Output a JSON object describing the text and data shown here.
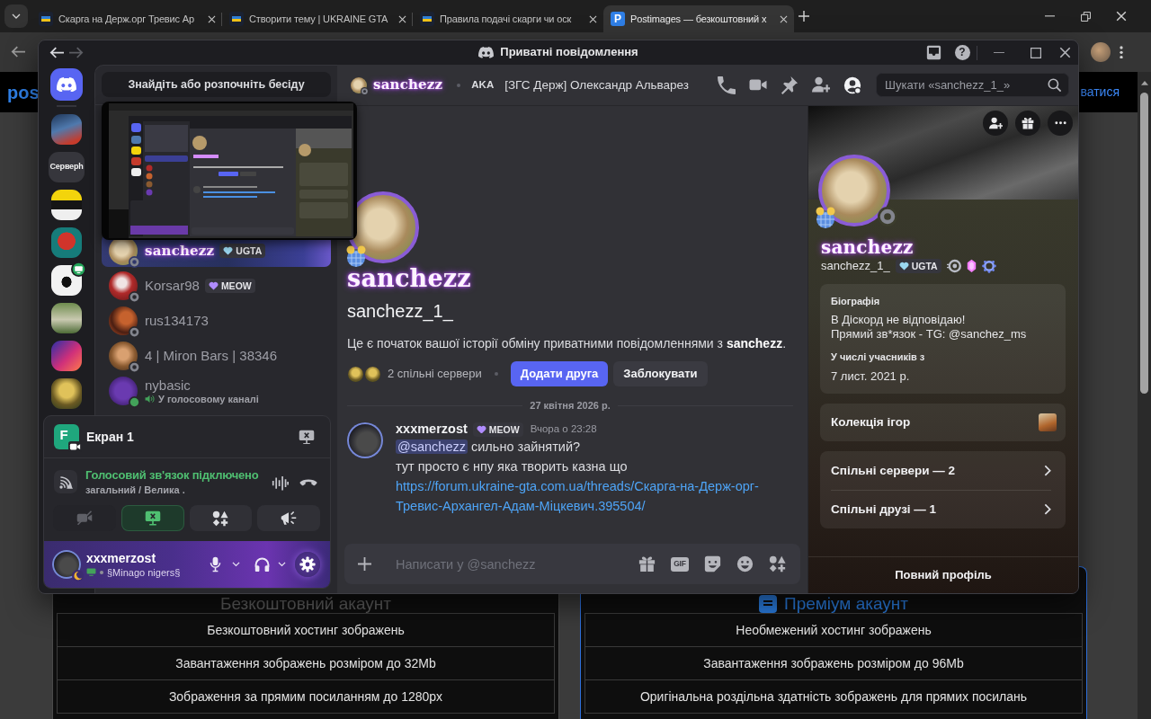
{
  "browser": {
    "tabs": [
      {
        "title": "Скарга на Держ.орг Тревис Ар",
        "favicon": {
          "kind": "crest"
        },
        "selected": false
      },
      {
        "title": "Створити тему | UKRAINE GTA",
        "favicon": {
          "kind": "crest"
        },
        "selected": false
      },
      {
        "title": "Правила подачі скарги чи оск",
        "favicon": {
          "kind": "crest"
        },
        "selected": false
      },
      {
        "title": "Postimages — безкоштовний х",
        "favicon": {
          "kind": "letter",
          "letter": "P"
        },
        "selected": true
      }
    ]
  },
  "page": {
    "logo": "pos",
    "account_link": "ватися",
    "plans": [
      {
        "title": "Безкоштовний акаунт",
        "featured": false,
        "features": [
          "Безкоштовний хостинг зображень",
          "Завантаження зображень розміром до 32Mb",
          "Зображення за прямим посиланням до 1280px"
        ]
      },
      {
        "title": "Преміум акаунт",
        "featured": true,
        "features": [
          "Необмежений хостинг зображень",
          "Завантаження зображень розміром до 96Mb",
          "Оригінальна роздільна здатність зображень для прямих посилань"
        ]
      }
    ]
  },
  "discord": {
    "title": "Приватні повідомлення",
    "help_label": "?",
    "servers": [
      {
        "kind": "image",
        "live": false
      },
      {
        "kind": "text",
        "label": "Серверh",
        "live": false
      },
      {
        "kind": "image",
        "live": false
      },
      {
        "kind": "image",
        "live": false
      },
      {
        "kind": "image",
        "live": true
      },
      {
        "kind": "image",
        "live": false
      },
      {
        "kind": "image",
        "live": false
      },
      {
        "kind": "image",
        "live": false
      }
    ],
    "search_button": "Знайдіть або розпочніть бесіду",
    "dms": [
      {
        "name": "sanchezz",
        "styled_name": true,
        "selected": true,
        "online": false,
        "tag": {
          "label": "UGTA",
          "color": "#9ad7f0"
        }
      },
      {
        "name": "Korsar98",
        "styled_name": false,
        "selected": false,
        "online": false,
        "tag": {
          "label": "MEOW",
          "color": "#b08cff"
        }
      },
      {
        "name": "rus134173",
        "styled_name": false,
        "selected": false,
        "online": false
      },
      {
        "name": "4 | Miron Bars | 38346",
        "styled_name": false,
        "selected": false,
        "online": false
      },
      {
        "name": "nybasic",
        "styled_name": false,
        "selected": false,
        "online": true,
        "activity": "У голосовому каналі"
      }
    ],
    "stream": {
      "app_letter": "F",
      "title": "Екран 1"
    },
    "voice": {
      "status": "Голосовий зв'язок підключено",
      "channel": "загальний / Велика .",
      "controls": [
        {
          "kind": "camera",
          "selected": false,
          "disabled": true
        },
        {
          "kind": "screen",
          "selected": true,
          "disabled": false
        },
        {
          "kind": "activities",
          "selected": false,
          "disabled": false
        },
        {
          "kind": "soundboard",
          "selected": false,
          "disabled": false
        }
      ]
    },
    "user": {
      "name": "xxxmerzost",
      "idle": true,
      "activity": "§Minago nigers§"
    },
    "chat": {
      "header": {
        "name": "sanchezz",
        "aka_label": "AKA",
        "aka": "[ЗГС Держ] Олександр Альварез",
        "actions": [
          {
            "kind": "call",
            "selected": false
          },
          {
            "kind": "video",
            "selected": false
          },
          {
            "kind": "pins",
            "selected": false
          },
          {
            "kind": "add_friends",
            "selected": false
          },
          {
            "kind": "profile",
            "selected": true
          }
        ],
        "search_placeholder": "Шукати «sanchezz_1_»"
      },
      "intro": {
        "display_name": "sanchezz",
        "username": "sanchezz_1_",
        "text": "Це є початок вашої історії обміну приватними повідомленнями з **sanchezz**.",
        "mutual_servers": "2 спільні сервери",
        "buttons": [
          {
            "label": "Додати друга",
            "kind": "primary"
          },
          {
            "label": "Заблокувати",
            "kind": "secondary"
          }
        ]
      },
      "date_divider": "27 квітня 2026 р.",
      "messages": [
        {
          "author": "xxxmerzost",
          "tag": {
            "label": "MEOW",
            "color": "#b08cff"
          },
          "time": "Вчора о 23:28",
          "lines": [
            {
              "kind": "mention",
              "mention": "@sanchezz",
              "text": "сильно зайнятий?"
            },
            {
              "kind": "text",
              "text": "тут просто є нпу яка творить казна що"
            },
            {
              "kind": "link",
              "text": "https://forum.ukraine-gta.com.ua/threads/Скарга-на-Держ-орг-Тревис-Архангел-Адам-Міцкевич.395504/"
            }
          ]
        }
      ],
      "composer": {
        "placeholder": "Написати у @sanchezz",
        "tools": [
          {
            "kind": "gift"
          },
          {
            "kind": "gif",
            "label": "GIF"
          },
          {
            "kind": "sticker"
          },
          {
            "kind": "emoji"
          },
          {
            "kind": "apps"
          }
        ]
      }
    },
    "profile": {
      "display_name": "sanchezz",
      "username": "sanchezz_1_",
      "online": false,
      "tag": {
        "label": "UGTA",
        "color": "#9ad7f0"
      },
      "badges": [
        {
          "kind": "boost"
        },
        {
          "kind": "gem"
        },
        {
          "kind": "quest"
        }
      ],
      "bio_title": "Біографія",
      "bio": "В Діскорд не відповідаю!\nПрямий зв*язок - TG: @sanchez_ms",
      "member_title": "У числі учасників з",
      "member_since": "7 лист. 2021 р.",
      "collection": "Колекція ігор",
      "links": [
        "Спільні сервери — 2",
        "Спільні друзі — 1"
      ],
      "footer": "Повний профіль"
    }
  }
}
